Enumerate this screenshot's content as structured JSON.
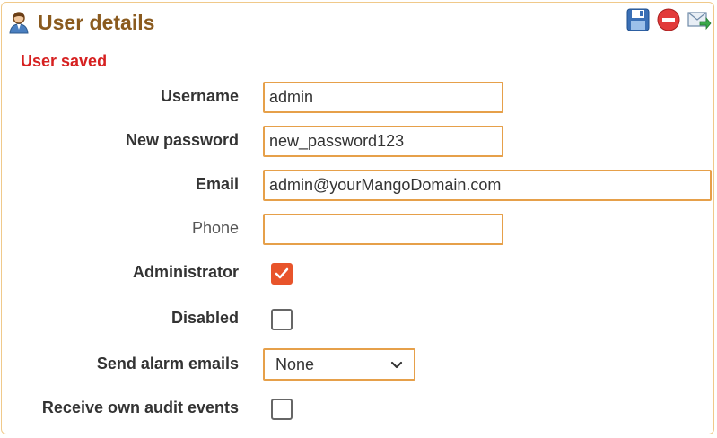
{
  "panel": {
    "title": "User details",
    "status_message": "User saved",
    "toolbar": {
      "save_icon": "save-icon",
      "delete_icon": "delete-icon",
      "email_icon": "send-email-icon"
    }
  },
  "form": {
    "username": {
      "label": "Username",
      "value": "admin"
    },
    "new_password": {
      "label": "New password",
      "value": "new_password123"
    },
    "email": {
      "label": "Email",
      "value": "admin@yourMangoDomain.com"
    },
    "phone": {
      "label": "Phone",
      "value": ""
    },
    "administrator": {
      "label": "Administrator",
      "checked": true
    },
    "disabled": {
      "label": "Disabled",
      "checked": false
    },
    "send_alarm_emails": {
      "label": "Send alarm emails",
      "selected": "None"
    },
    "receive_own_audit_events": {
      "label": "Receive own audit events",
      "checked": false
    }
  },
  "colors": {
    "accent_border": "#e6a04a",
    "title": "#8a5a1e",
    "status": "#d62020",
    "checkbox_checked": "#e8542b"
  }
}
